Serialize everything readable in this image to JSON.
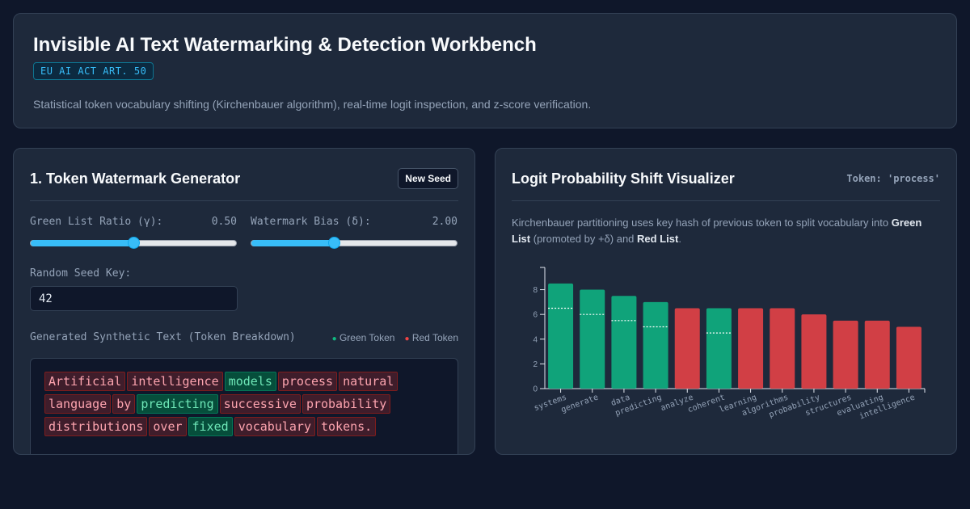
{
  "header": {
    "title": "Invisible AI Text Watermarking & Detection Workbench",
    "badge": "EU AI ACT ART. 50",
    "subtitle": "Statistical token vocabulary shifting (Kirchenbauer algorithm), real-time logit inspection, and z-score verification."
  },
  "generator": {
    "title": "1. Token Watermark Generator",
    "new_seed_label": "New Seed",
    "gamma_label": "Green List Ratio (γ):",
    "gamma_value": "0.50",
    "gamma_fraction": 0.5,
    "delta_label": "Watermark Bias (δ):",
    "delta_value": "2.00",
    "delta_fraction": 0.4,
    "seed_label": "Random Seed Key:",
    "seed_value": "42",
    "text_label": "Generated Synthetic Text (Token Breakdown)",
    "legend_green": "Green Token",
    "legend_red": "Red Token",
    "tokens": [
      {
        "text": "Artificial",
        "list": "red"
      },
      {
        "text": "intelligence",
        "list": "red"
      },
      {
        "text": "models",
        "list": "green"
      },
      {
        "text": "process",
        "list": "red"
      },
      {
        "text": "natural",
        "list": "red"
      },
      {
        "text": "language",
        "list": "red"
      },
      {
        "text": "by",
        "list": "red"
      },
      {
        "text": "predicting",
        "list": "green"
      },
      {
        "text": "successive",
        "list": "red"
      },
      {
        "text": "probability",
        "list": "red"
      },
      {
        "text": "distributions",
        "list": "red"
      },
      {
        "text": "over",
        "list": "red"
      },
      {
        "text": "fixed",
        "list": "green"
      },
      {
        "text": "vocabulary",
        "list": "red"
      },
      {
        "text": "tokens.",
        "list": "red"
      }
    ]
  },
  "visualizer": {
    "title": "Logit Probability Shift Visualizer",
    "token_label": "Token: 'process'",
    "desc_pre": "Kirchenbauer partitioning uses key hash of previous token to split vocabulary into ",
    "desc_green": "Green List",
    "desc_mid": " (promoted by +δ) and ",
    "desc_red": "Red List",
    "desc_post": "."
  },
  "colors": {
    "green": "#10a37a",
    "red": "#d13f45",
    "accent": "#38bdf8"
  },
  "chart_data": {
    "type": "bar",
    "categories": [
      "systems",
      "generate",
      "data",
      "predicting",
      "analyze",
      "coherent",
      "learning",
      "algorithms",
      "probability",
      "structures",
      "evaluating",
      "intelligence"
    ],
    "values": [
      8.5,
      8.0,
      7.5,
      7.0,
      6.5,
      6.5,
      6.5,
      6.5,
      6.0,
      5.5,
      5.5,
      5.0
    ],
    "base_values": [
      6.5,
      6.0,
      5.5,
      5.0,
      null,
      4.5,
      null,
      null,
      null,
      null,
      null,
      null
    ],
    "lists": [
      "green",
      "green",
      "green",
      "green",
      "red",
      "green",
      "red",
      "red",
      "red",
      "red",
      "red",
      "red"
    ],
    "yticks": [
      0,
      2,
      4,
      6,
      8
    ],
    "ylim": [
      0,
      9.8
    ],
    "title": "",
    "xlabel": "",
    "ylabel": ""
  }
}
